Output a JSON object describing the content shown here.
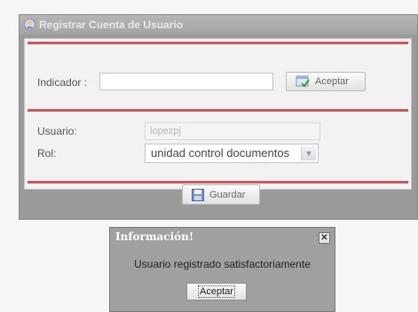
{
  "window": {
    "title": "Registrar Cuenta de Usuario"
  },
  "indicador": {
    "label": "Indicador :",
    "value": "",
    "button_label": "Aceptar"
  },
  "usuario": {
    "label": "Usuario:",
    "value": "lopezpj"
  },
  "rol": {
    "label": "Rol:",
    "selected": "unidad control documentos"
  },
  "guardar": {
    "label": "Guardar"
  },
  "popup": {
    "title": "Información!",
    "close_glyph": "✕",
    "message": "Usuario registrado satisfactoriamente",
    "button_label": "Aceptar"
  },
  "colors": {
    "accent_red": "#c85a5e",
    "window_gray": "#9a9a9a"
  }
}
